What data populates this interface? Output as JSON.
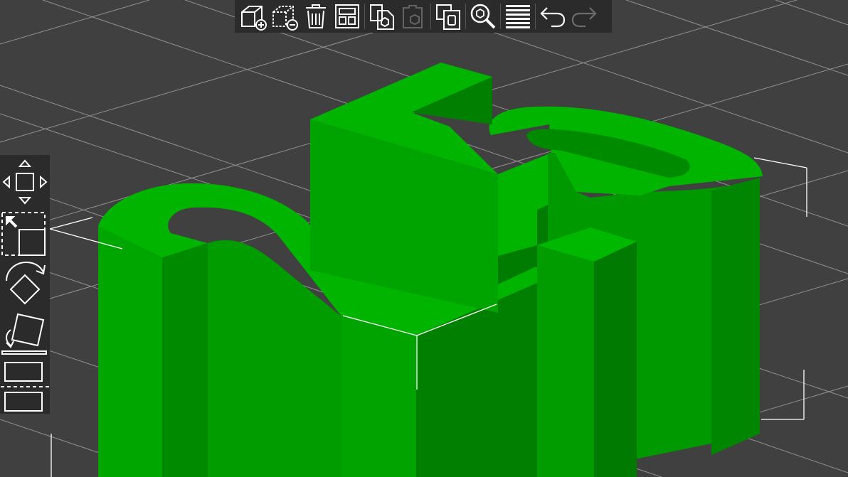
{
  "app": {
    "type": "3d-slicer-plater-view"
  },
  "colors": {
    "background": "#404040",
    "grid": "#c8c8c8",
    "model_light": "#00b300",
    "model_mid": "#009900",
    "model_dark": "#007a00",
    "toolbar_bg": "#2b2b2b",
    "icon": "#ffffff"
  },
  "top_toolbar": {
    "buttons": [
      {
        "icon": "add-icon",
        "enabled": true
      },
      {
        "icon": "delete-icon",
        "enabled": true
      },
      {
        "icon": "delete-all-icon",
        "enabled": true
      },
      {
        "icon": "arrange-icon",
        "enabled": true
      },
      {
        "icon": "copy-icon",
        "enabled": true
      },
      {
        "icon": "paste-icon",
        "enabled": false
      },
      {
        "icon": "instance-add-icon",
        "enabled": true
      },
      {
        "icon": "search-icon",
        "enabled": true
      },
      {
        "icon": "layers-icon",
        "enabled": true
      },
      {
        "icon": "undo-icon",
        "enabled": true
      },
      {
        "icon": "redo-icon",
        "enabled": false
      }
    ]
  },
  "left_toolbar": {
    "tools": [
      {
        "icon": "move-icon"
      },
      {
        "icon": "scale-icon"
      },
      {
        "icon": "rotate-icon"
      },
      {
        "icon": "place-on-face-icon"
      },
      {
        "icon": "cut-icon"
      }
    ]
  }
}
